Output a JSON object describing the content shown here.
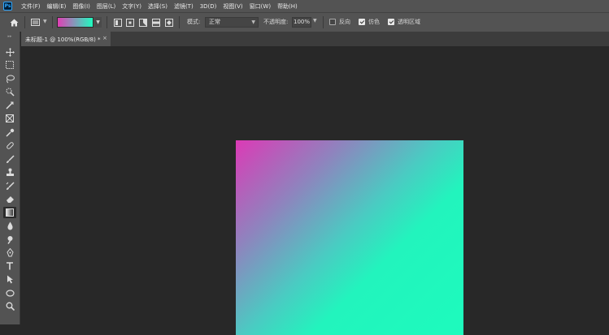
{
  "menubar": {
    "app_icon": "photoshop-logo",
    "app_icon_text": "Ps",
    "items": [
      {
        "label": "文件(F)"
      },
      {
        "label": "编辑(E)"
      },
      {
        "label": "图像(I)"
      },
      {
        "label": "图层(L)"
      },
      {
        "label": "文字(Y)"
      },
      {
        "label": "选择(S)"
      },
      {
        "label": "滤镜(T)"
      },
      {
        "label": "3D(D)"
      },
      {
        "label": "视图(V)"
      },
      {
        "label": "窗口(W)"
      },
      {
        "label": "帮助(H)"
      }
    ]
  },
  "options_bar": {
    "home_icon": "home-icon",
    "tool_preset_icon": "gradient-tool-preset-icon",
    "gradient": {
      "start_color": "#e03fb4",
      "end_color": "#1ffbbf"
    },
    "gradient_types": [
      "linear-gradient-icon",
      "radial-gradient-icon",
      "angle-gradient-icon",
      "reflected-gradient-icon",
      "diamond-gradient-icon"
    ],
    "mode_label": "模式:",
    "mode_value": "正常",
    "opacity_label": "不透明度:",
    "opacity_value": "100%",
    "reverse": {
      "label": "反向",
      "checked": false
    },
    "dither": {
      "label": "仿色",
      "checked": true
    },
    "transparency": {
      "label": "透明区域",
      "checked": true
    }
  },
  "document": {
    "tab_title": "未标题-1 @ 100%(RGB/8) *",
    "close_glyph": "×",
    "canvas_gradient": {
      "start_color": "#dc3ab6",
      "end_color": "#1dfbbd",
      "direction": "top-left to bottom-right"
    }
  },
  "toolbar": {
    "active_tool": "gradient-tool",
    "tools": [
      "move-tool",
      "rectangular-marquee-tool",
      "lasso-tool",
      "quick-selection-tool",
      "crop-tool",
      "frame-tool",
      "eyedropper-tool",
      "spot-healing-brush-tool",
      "brush-tool",
      "clone-stamp-tool",
      "history-brush-tool",
      "eraser-tool",
      "gradient-tool",
      "blur-tool",
      "dodge-tool",
      "pen-tool",
      "type-tool",
      "path-selection-tool",
      "ellipse-tool",
      "zoom-tool"
    ]
  }
}
